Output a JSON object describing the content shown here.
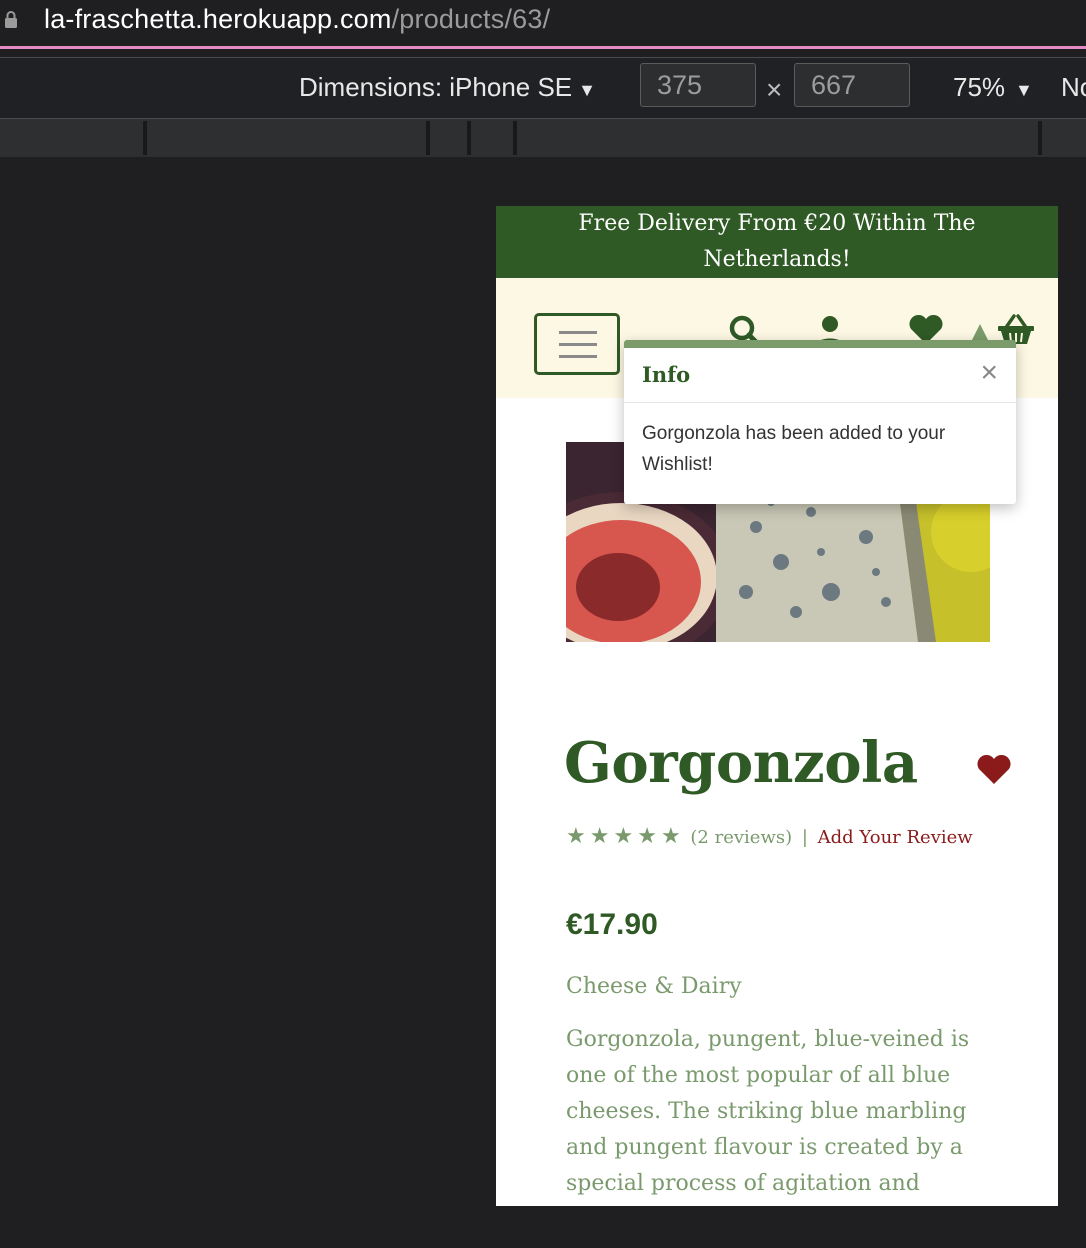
{
  "browser": {
    "url_host": "la-fraschetta.herokuapp.com",
    "url_path": "/products/63/"
  },
  "devtools": {
    "dimensions_label": "Dimensions: iPhone SE",
    "width": "375",
    "height": "667",
    "times": "×",
    "zoom": "75%",
    "more_label": "No"
  },
  "site": {
    "banner_line1": "Free Delivery From €20 Within The",
    "banner_line2": "Netherlands!"
  },
  "toast": {
    "title": "Info",
    "close": "×",
    "message": "Gorgonzola has been added to your Wishlist!"
  },
  "product": {
    "name": "Gorgonzola",
    "rating_stars": 5,
    "reviews_text": "(2 reviews)",
    "separator": "|",
    "add_review": "Add Your Review",
    "price": "€17.90",
    "category": "Cheese & Dairy",
    "description": "Gorgonzola, pungent, blue-veined is one of the most popular of all blue cheeses. The striking blue marbling and pungent flavour is created by a special process of agitation and"
  },
  "colors": {
    "brand_green": "#2f5a25",
    "muted_green": "#7a9a6d",
    "accent_red": "#8b1a1a",
    "navbar_bg": "#fdf8e4"
  },
  "icons": [
    "lock-icon",
    "hamburger-icon",
    "search-icon",
    "account-icon",
    "wishlist-heart-icon",
    "basket-icon",
    "close-icon",
    "star-icon",
    "product-heart-icon"
  ]
}
